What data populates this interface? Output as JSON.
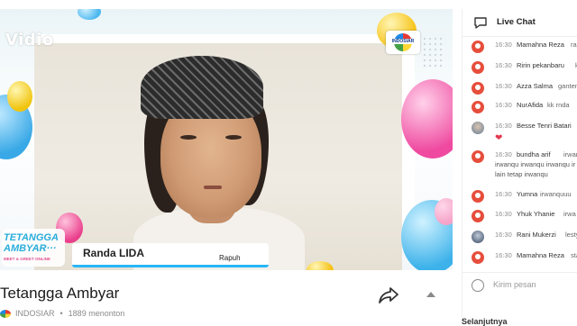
{
  "brand": {
    "vidio_logo": "Vidio",
    "channel_logo": "INDOSIAR"
  },
  "show": {
    "logo_line1": "TETANGGA",
    "logo_line2": "AMBYAR···",
    "logo_tagline": "MEET & GREET ONLINE"
  },
  "lower_third": {
    "name": "Randa LIDA",
    "song": "Rapuh"
  },
  "video": {
    "title": "Tetangga Ambyar",
    "channel": "INDOSIAR",
    "views": "1889 menonton"
  },
  "chat": {
    "header": "Live Chat",
    "messages": [
      {
        "time": "16:30",
        "user": "Mamahna Reza",
        "text": "rap"
      },
      {
        "time": "16:30",
        "user": "Ririn pekanbaru",
        "text": "k"
      },
      {
        "time": "16:30",
        "user": "Azza Salma",
        "text": "ganteng"
      },
      {
        "time": "16:30",
        "user": "NurAfida",
        "text": "kk rnda"
      },
      {
        "time": "16:30",
        "user": "Besse Tenri Batari",
        "text": ""
      },
      {
        "time": "16:30",
        "user": "bundha arif",
        "text": "irwanq",
        "cont": [
          "irwanqu irwanqu irwanqu ir",
          "lain tetap irwanqu"
        ]
      },
      {
        "time": "16:30",
        "user": "Yumna",
        "text": "irwanquuu"
      },
      {
        "time": "16:30",
        "user": "Yhuk Yhanie",
        "text": "irwa"
      },
      {
        "time": "16:30",
        "user": "Rani Mukerzi",
        "text": "lesty"
      },
      {
        "time": "16:30",
        "user": "Mamahna Reza",
        "text": "sta"
      }
    ],
    "input_placeholder": "Kirim pesan"
  },
  "next_section": "Selanjutnya",
  "colors": {
    "accent": "#29b6f6",
    "avatar_default": "#e64e3c",
    "heart": "#e53950"
  }
}
